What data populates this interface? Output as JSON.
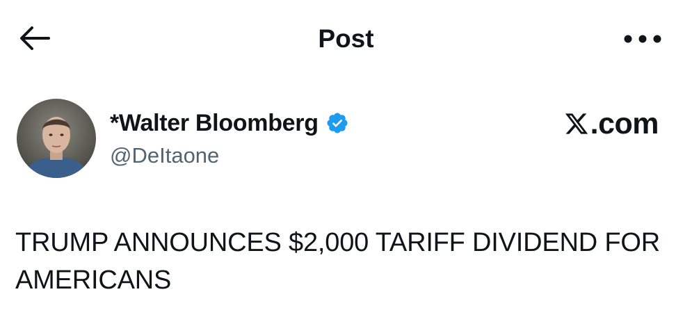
{
  "header": {
    "title": "Post",
    "back_icon": "arrow-left-icon",
    "more_icon": "more-dots-icon"
  },
  "author": {
    "display_name": "*Walter Bloomberg",
    "handle": "@DeItaone",
    "verified": true,
    "verified_color": "#1d9bf0",
    "avatar_icon": "avatar-photo"
  },
  "source": {
    "label": ".com",
    "logo_icon": "x-logo-icon"
  },
  "post": {
    "text": "TRUMP ANNOUNCES $2,000 TARIFF DIVIDEND FOR AMERICANS"
  },
  "colors": {
    "text": "#0f1419",
    "secondary": "#536471",
    "accent": "#1d9bf0",
    "background": "#ffffff"
  }
}
